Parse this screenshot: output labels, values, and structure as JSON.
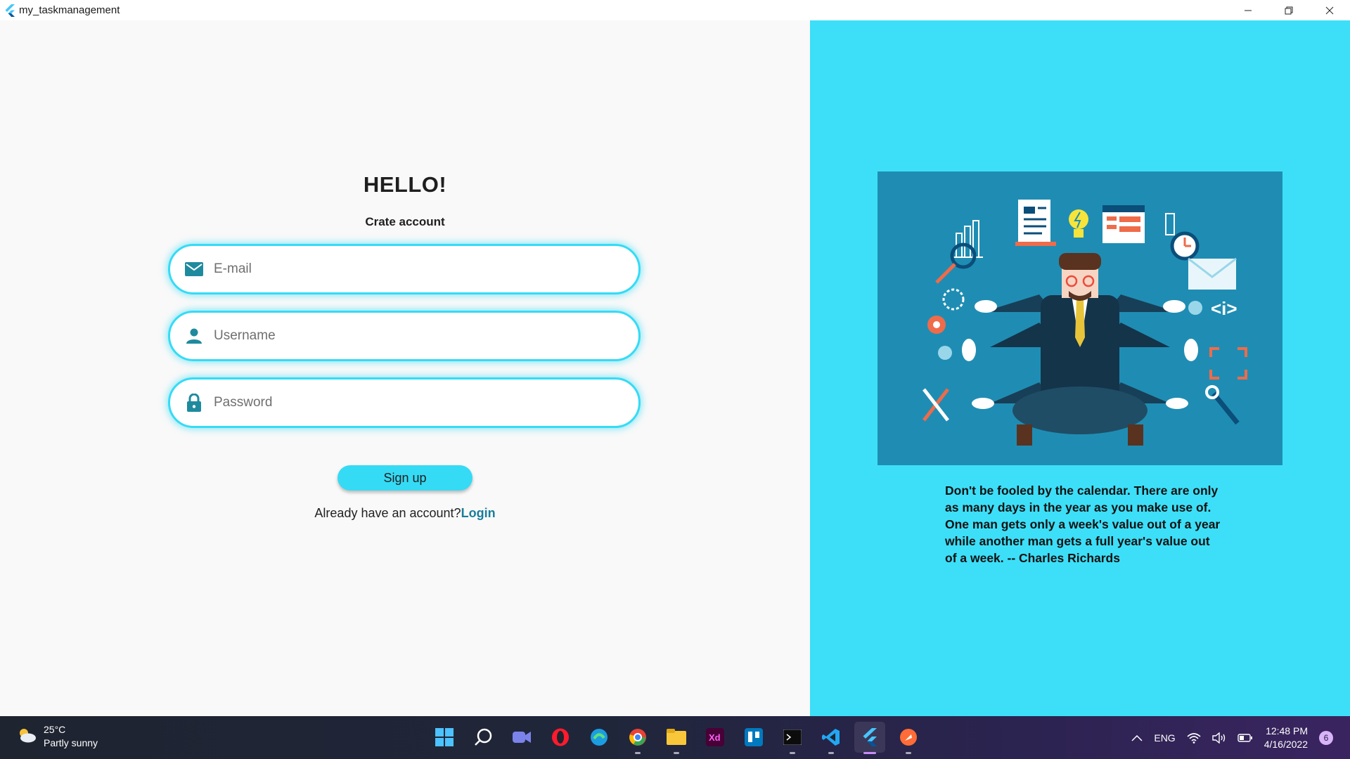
{
  "window": {
    "title": "my_taskmanagement",
    "controls": [
      "minimize",
      "restore",
      "close"
    ]
  },
  "signup_form": {
    "heading": "HELLO!",
    "subheading": "Crate account",
    "email": {
      "placeholder": "E-mail",
      "value": "",
      "icon": "mail-icon"
    },
    "username": {
      "placeholder": "Username",
      "value": "",
      "icon": "person-icon"
    },
    "password": {
      "placeholder": "Password",
      "value": "",
      "icon": "lock-icon"
    },
    "signup_label": "Sign up",
    "login_prompt": "Already have an account?",
    "login_link": "Login"
  },
  "side_panel": {
    "illustration": "multitasking-businessman-illustration",
    "quote": "Don't be fooled by the calendar. There are only as many days in the year as you make use of. One man gets only a week's value out of a year while another man gets a full year's value out of a week. -- Charles Richards"
  },
  "taskbar": {
    "weather": {
      "temp": "25°C",
      "condition": "Partly sunny"
    },
    "apps": [
      "start-icon",
      "search-icon",
      "teams-icon",
      "opera-icon",
      "edge-icon",
      "chrome-icon",
      "file-explorer-icon",
      "adobe-xd-icon",
      "trello-icon",
      "terminal-icon",
      "vscode-icon",
      "flutter-icon",
      "postman-icon"
    ],
    "tray": {
      "language": "ENG",
      "time": "12:48 PM",
      "date": "4/16/2022",
      "notifications": "6"
    }
  },
  "colors": {
    "accent_cyan": "#3ddff8",
    "field_border": "#35dbf5",
    "login_link": "#1a7d9c",
    "illustration_bg": "#1f8db3"
  }
}
